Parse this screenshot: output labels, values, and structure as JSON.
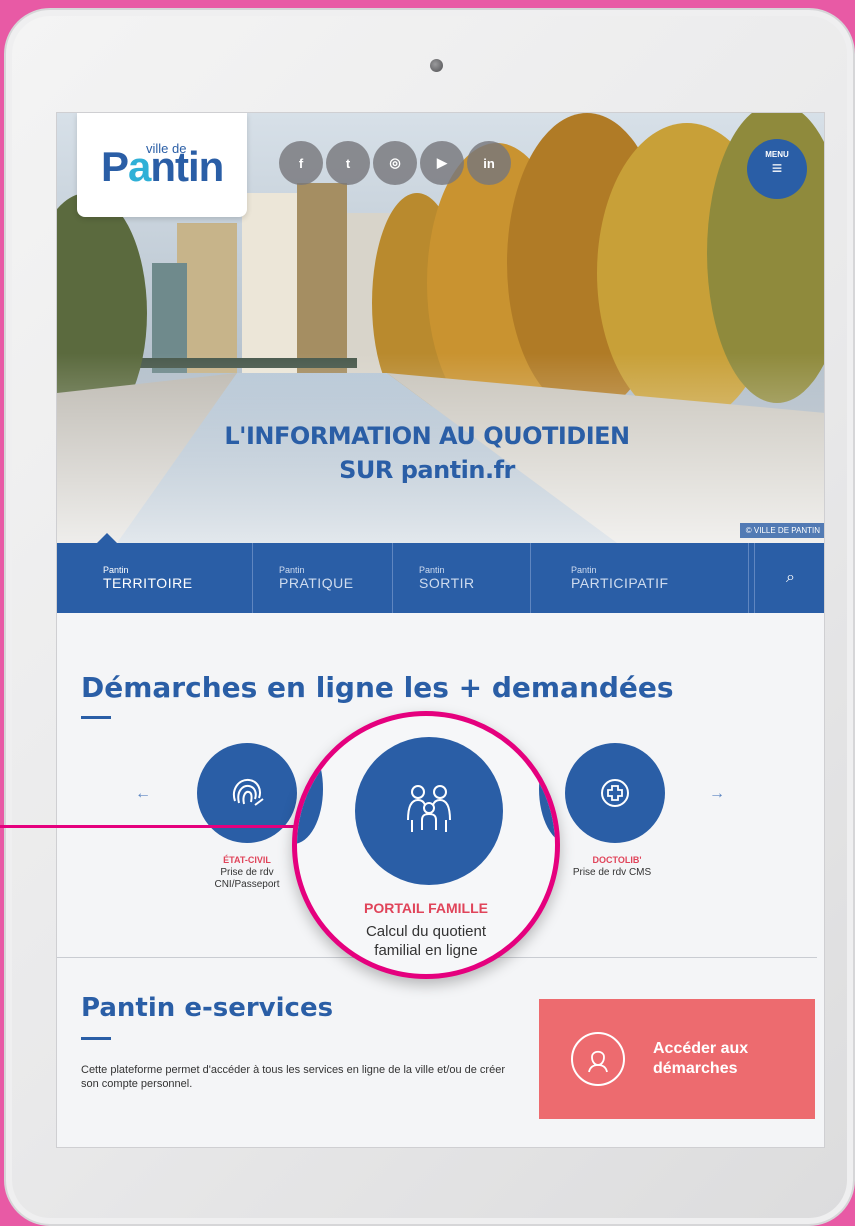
{
  "colors": {
    "brand_blue": "#2a5ea6",
    "accent_red": "#e0445a",
    "cta_coral": "#ed6b6f",
    "highlight_pink": "#e5007e"
  },
  "logo": {
    "prefix": "ville de",
    "name_start": "P",
    "name_accent": "a",
    "name_end": "ntin"
  },
  "socials": [
    "f",
    "t",
    "◎",
    "▶",
    "in"
  ],
  "menu": {
    "label": "MENU"
  },
  "hero": {
    "line1": "L'INFORMATION AU QUOTIDIEN",
    "line2": "SUR pantin.fr",
    "credit": "© VILLE DE PANTIN"
  },
  "nav": {
    "items": [
      {
        "small": "Pantin",
        "big": "TERRITOIRE"
      },
      {
        "small": "Pantin",
        "big": "PRATIQUE"
      },
      {
        "small": "Pantin",
        "big": "SORTIR"
      },
      {
        "small": "Pantin",
        "big": "PARTICIPATIF"
      }
    ]
  },
  "demarches": {
    "title": "Démarches en ligne les + demandées",
    "prev_arrow": "←",
    "next_arrow": "→",
    "items": [
      {
        "tag": "ÉTAT-CIVIL",
        "desc_line1": "Prise de rdv",
        "desc_line2": "CNI/Passeport",
        "icon": "fingerprint-icon"
      },
      {
        "tag": "PORTAIL FAMILLE",
        "desc_line1": "Calcul du quotient",
        "desc_line2": "familial en ligne",
        "icon": "family-icon"
      },
      {
        "tag": "DOCTOLIB'",
        "desc_line1": "Prise de rdv CMS",
        "desc_line2": "",
        "icon": "medical-cross-icon"
      }
    ]
  },
  "eservices": {
    "title": "Pantin e-services",
    "description": "Cette plateforme permet d'accéder à tous les services en ligne de la ville et/ou de créer son compte personnel.",
    "cta_line1": "Accéder aux",
    "cta_line2": "démarches"
  }
}
